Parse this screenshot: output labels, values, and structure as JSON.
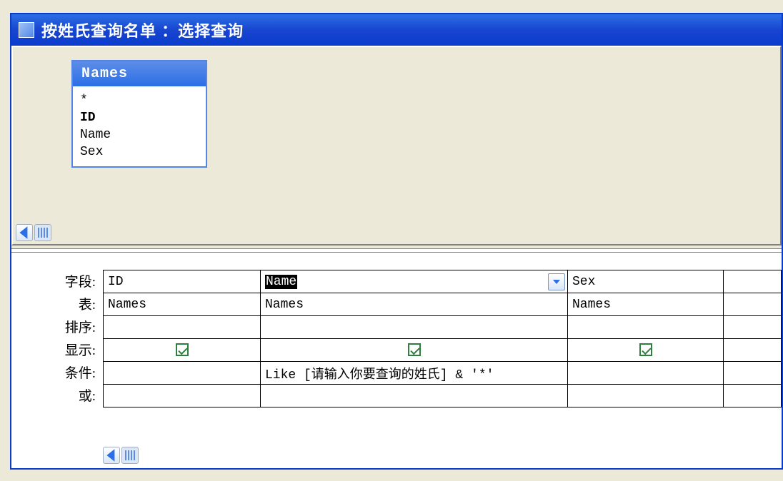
{
  "window": {
    "title": "按姓氏查询名单 ：选择查询"
  },
  "table_source": {
    "name": "Names",
    "fields": [
      "*",
      "ID",
      "Name",
      "Sex"
    ]
  },
  "row_labels": {
    "field": "字段:",
    "table": "表:",
    "sort": "排序:",
    "show": "显示:",
    "criteria": "条件:",
    "or": "或:"
  },
  "grid": {
    "columns": [
      {
        "field": "ID",
        "table": "Names",
        "sort": "",
        "show": true,
        "criteria": "",
        "or": ""
      },
      {
        "field": "Name",
        "field_selected": true,
        "active": true,
        "table": "Names",
        "sort": "",
        "show": true,
        "criteria": "Like [请输入你要查询的姓氏] & '*'",
        "or": ""
      },
      {
        "field": "Sex",
        "table": "Names",
        "sort": "",
        "show": true,
        "criteria": "",
        "or": ""
      },
      {
        "field": "",
        "table": "",
        "sort": "",
        "show": false,
        "criteria": "",
        "or": ""
      }
    ]
  }
}
